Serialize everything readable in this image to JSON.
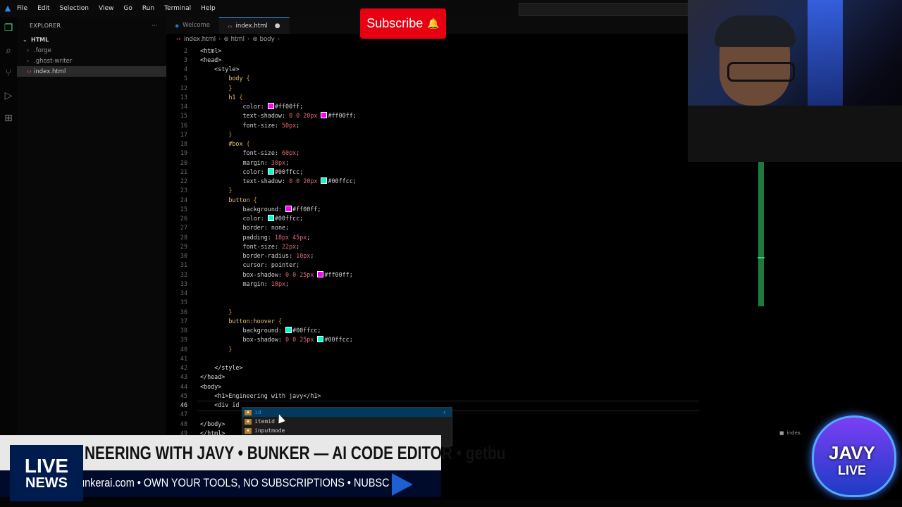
{
  "menu": [
    "File",
    "Edit",
    "Selection",
    "View",
    "Go",
    "Run",
    "Terminal",
    "Help"
  ],
  "explorer": {
    "title": "EXPLORER",
    "more": "···",
    "root": "HTML",
    "items": [
      {
        "label": ".forge",
        "type": "folder"
      },
      {
        "label": ".ghost-writer",
        "type": "folder"
      },
      {
        "label": "index.html",
        "type": "file",
        "selected": true
      }
    ]
  },
  "tabs": [
    {
      "label": "Welcome",
      "active": false
    },
    {
      "label": "index.html",
      "active": true,
      "modified": true
    }
  ],
  "breadcrumb": [
    "index.html",
    "html",
    "body"
  ],
  "editor": {
    "lines": [
      {
        "n": "2",
        "html": "<span class='tag'>&lt;html&gt;</span>"
      },
      {
        "n": "3",
        "html": "<span class='tag'>&lt;head&gt;</span>"
      },
      {
        "n": "4",
        "html": "    <span class='tag'>&lt;style&gt;</span>"
      },
      {
        "n": "5",
        "html": "        <span class='sel'>body</span> <span class='brace'>{</span>"
      },
      {
        "n": "12",
        "html": "        <span class='brace'>}</span>"
      },
      {
        "n": "13",
        "html": "        <span class='sel'>h1</span> <span class='brace'>{</span>"
      },
      {
        "n": "14",
        "html": "            <span class='prop'>color:</span> <span class='sw' style='background:#ff00ff'></span><span class='val'>#ff00ff;</span>"
      },
      {
        "n": "15",
        "html": "            <span class='prop'>text-shadow:</span> <span class='num'>0 0 20px</span> <span class='sw' style='background:#ff00ff'></span><span class='val'>#ff00ff;</span>"
      },
      {
        "n": "16",
        "html": "            <span class='prop'>font-size:</span> <span class='num'>50px</span>;"
      },
      {
        "n": "17",
        "html": "        <span class='brace'>}</span>"
      },
      {
        "n": "18",
        "html": "        <span class='sel'>#box</span> <span class='brace'>{</span>"
      },
      {
        "n": "19",
        "html": "            <span class='prop'>font-size:</span> <span class='num'>60px</span>;"
      },
      {
        "n": "20",
        "html": "            <span class='prop'>margin:</span> <span class='num'>30px</span>;"
      },
      {
        "n": "21",
        "html": "            <span class='prop'>color:</span> <span class='sw' style='background:#00ffcc'></span><span class='val'>#00ffcc;</span>"
      },
      {
        "n": "22",
        "html": "            <span class='prop'>text-shadow:</span> <span class='num'>0 0 20px</span> <span class='sw' style='background:#00ffcc'></span><span class='val'>#00ffcc;</span>"
      },
      {
        "n": "23",
        "html": "        <span class='brace'>}</span>"
      },
      {
        "n": "24",
        "html": "        <span class='sel'>button</span> <span class='brace'>{</span>"
      },
      {
        "n": "25",
        "html": "            <span class='prop'>background:</span> <span class='sw' style='background:#ff00ff'></span><span class='val'>#ff00ff;</span>"
      },
      {
        "n": "26",
        "html": "            <span class='prop'>color:</span> <span class='sw' style='background:#00ffcc'></span><span class='val'>#00ffcc;</span>"
      },
      {
        "n": "27",
        "html": "            <span class='prop'>border:</span> <span class='val'>none;</span>"
      },
      {
        "n": "28",
        "html": "            <span class='prop'>padding:</span> <span class='num'>18px 45px</span>;"
      },
      {
        "n": "29",
        "html": "            <span class='prop'>font-size:</span> <span class='num'>22px</span>;"
      },
      {
        "n": "30",
        "html": "            <span class='prop'>border-radius:</span> <span class='num'>10px</span>;"
      },
      {
        "n": "31",
        "html": "            <span class='prop'>cursor:</span> <span class='val'>pointer;</span>"
      },
      {
        "n": "32",
        "html": "            <span class='prop'>box-shadow:</span> <span class='num'>0 0 25px</span> <span class='sw' style='background:#ff00ff'></span><span class='val'>#ff00ff;</span>"
      },
      {
        "n": "33",
        "html": "            <span class='prop'>margin:</span> <span class='num'>10px</span>;"
      },
      {
        "n": "34",
        "html": ""
      },
      {
        "n": "35",
        "html": ""
      },
      {
        "n": "36",
        "html": "        <span class='brace'>}</span>"
      },
      {
        "n": "37",
        "html": "        <span class='sel'>button:hoover</span> <span class='brace'>{</span>"
      },
      {
        "n": "38",
        "html": "            <span class='prop'>background:</span> <span class='sw' style='background:#00ffcc'></span><span class='val'>#00ffcc;</span>"
      },
      {
        "n": "39",
        "html": "            <span class='prop'>box-shadow:</span> <span class='num'>0 0 25px</span> <span class='sw' style='background:#00ffcc'></span><span class='val'>#00ffcc;</span>"
      },
      {
        "n": "40",
        "html": "        <span class='brace'>}</span>"
      },
      {
        "n": "41",
        "html": ""
      },
      {
        "n": "42",
        "html": "    <span class='tag'>&lt;/style&gt;</span>"
      },
      {
        "n": "43",
        "html": "<span class='tag'>&lt;/head&gt;</span>"
      },
      {
        "n": "44",
        "html": "<span class='tag'>&lt;body&gt;</span>"
      },
      {
        "n": "45",
        "html": "    <span class='tag'>&lt;h1&gt;</span>Engineering with javy<span class='tag'>&lt;/h1&gt;</span>"
      },
      {
        "n": "46",
        "html": "    <span class='tag'>&lt;div</span> id",
        "current": true
      },
      {
        "n": "47",
        "html": ""
      },
      {
        "n": "48",
        "html": "<span class='tag'>&lt;/body&gt;</span>"
      },
      {
        "n": "49",
        "html": "<span class='tag'>&lt;/html&gt;</span>"
      }
    ]
  },
  "suggest": [
    {
      "label": "id",
      "active": true
    },
    {
      "label": "itemid",
      "active": false
    },
    {
      "label": "inputmode",
      "active": false
    }
  ],
  "overlay": {
    "subscribe": "Subscribe",
    "ticker_top": "NEERING WITH JAVY • BUNKER — AI CODE EDITOR • getbu",
    "ticker_bottom": "tbunkerai.com  •  OWN YOUR TOOLS, NO SUBSCRIPTIONS  •  NUBSC",
    "live1": "LIVE",
    "live2": "NEWS",
    "badge1": "JAVY",
    "badge2": "LIVE",
    "mini_tab": "index."
  },
  "colors": {
    "magenta": "#ff00ff",
    "cyan": "#00ffcc",
    "accent": "#2b8be6",
    "subscribe": "#e60012"
  }
}
